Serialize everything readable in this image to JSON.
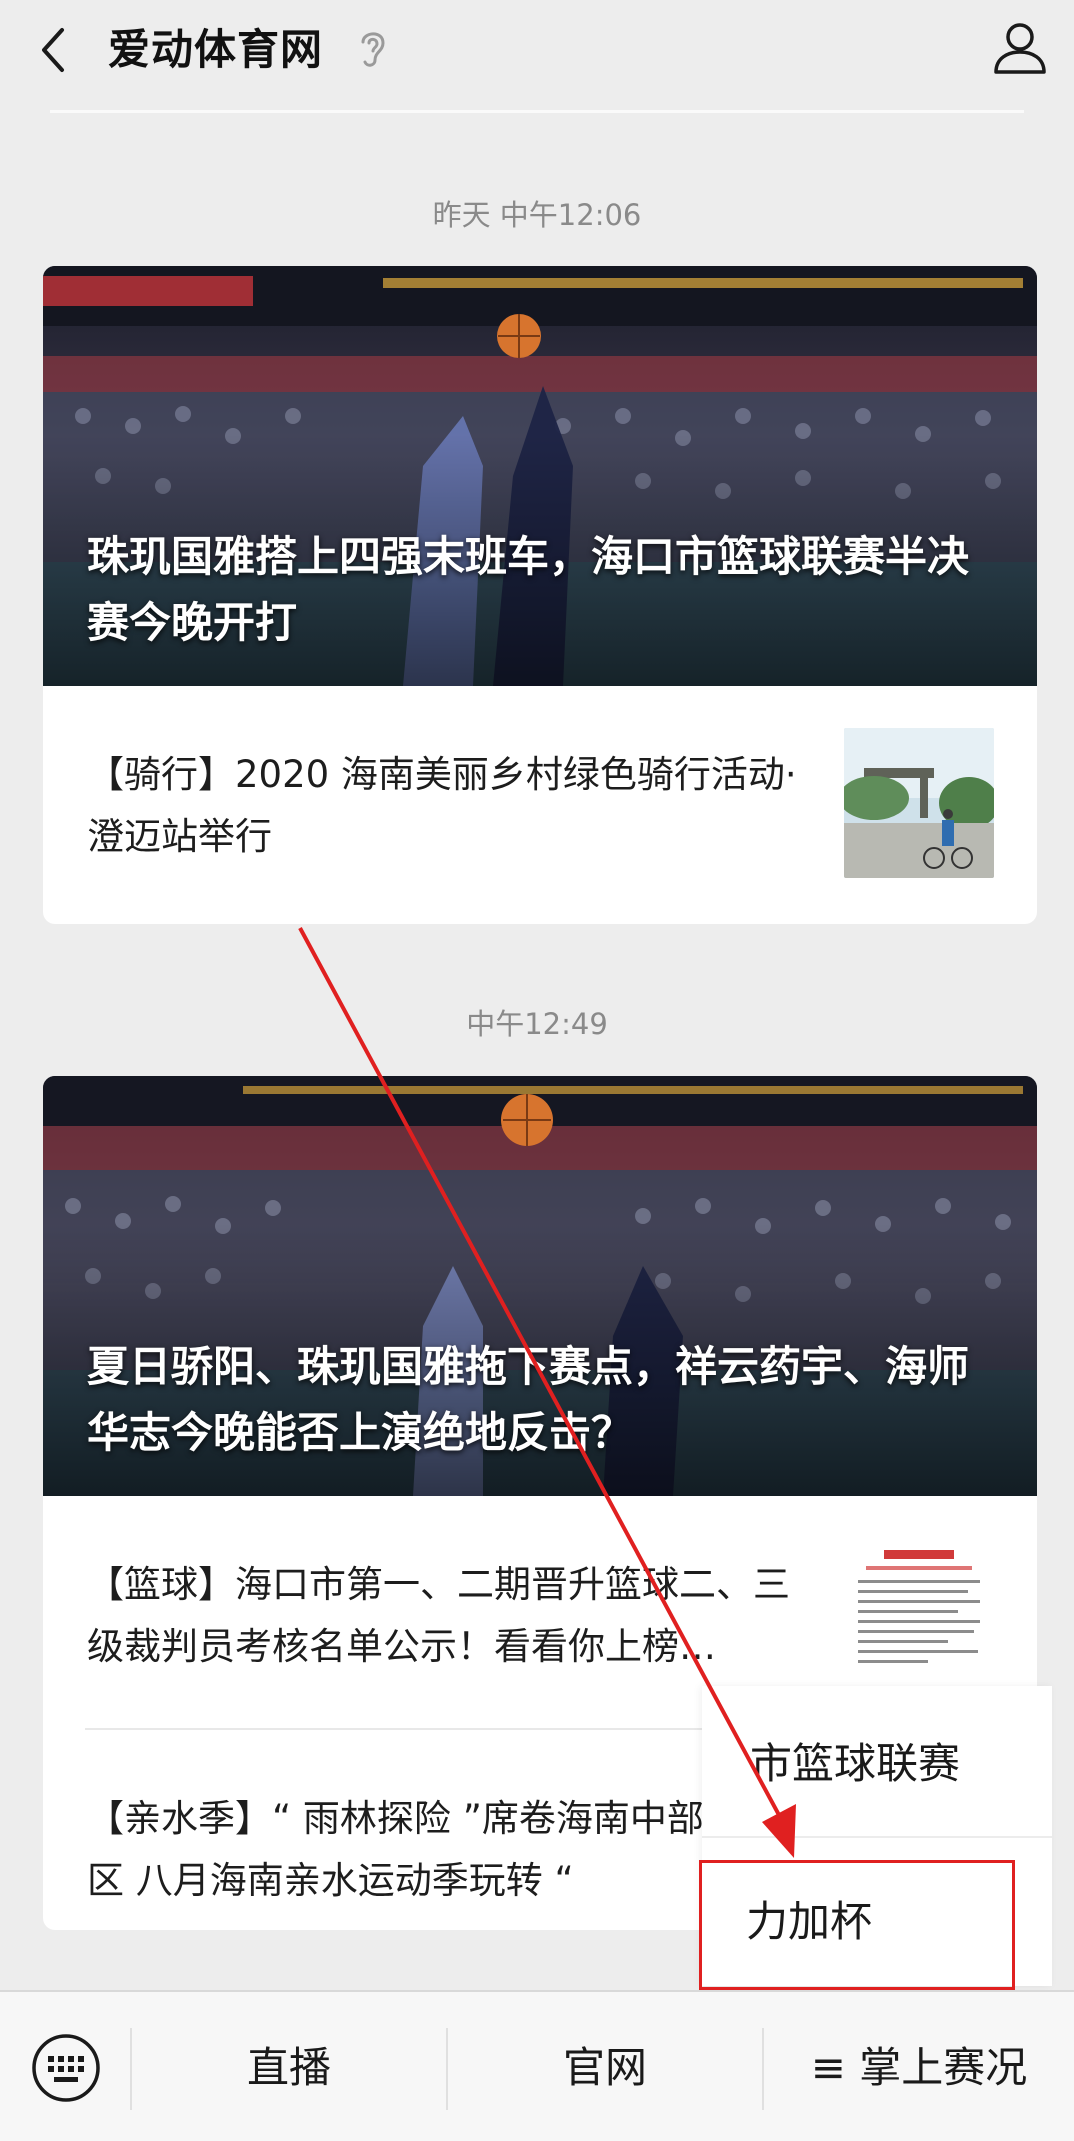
{
  "header": {
    "title": "爱动体育网",
    "back_icon": "chevron-left-icon",
    "ear_icon": "ear-icon",
    "user_icon": "user-icon"
  },
  "feed": [
    {
      "timestamp": "昨天 中午12:06",
      "hero_title": "珠玑国雅搭上四强末班车，海口市篮球联赛半决赛今晚开打",
      "items": [
        {
          "text": "【骑行】2020 海南美丽乡村绿色骑行活动·澄迈站举行"
        }
      ]
    },
    {
      "timestamp": "中午12:49",
      "hero_title": "夏日骄阳、珠玑国雅拖下赛点，祥云药宇、海师华志今晚能否上演绝地反击？",
      "items": [
        {
          "text": "【篮球】海口市第一、二期晋升篮球二、三级裁判员考核名单公示！看看你上榜…"
        },
        {
          "text": "【亲水季】“ 雨林探险 ”席卷海南中部雨林区 八月海南亲水运动季玩转 “"
        }
      ]
    }
  ],
  "popup_menu": {
    "items": [
      "市篮球联赛",
      "力加杯"
    ],
    "highlighted": "力加杯"
  },
  "bottom_menu": {
    "keyboard_icon": "keyboard-icon",
    "items": [
      "直播",
      "官网",
      "≡ 掌上赛况"
    ]
  },
  "colors": {
    "background": "#ededed",
    "card": "#ffffff",
    "annotation_red": "#e02020"
  }
}
